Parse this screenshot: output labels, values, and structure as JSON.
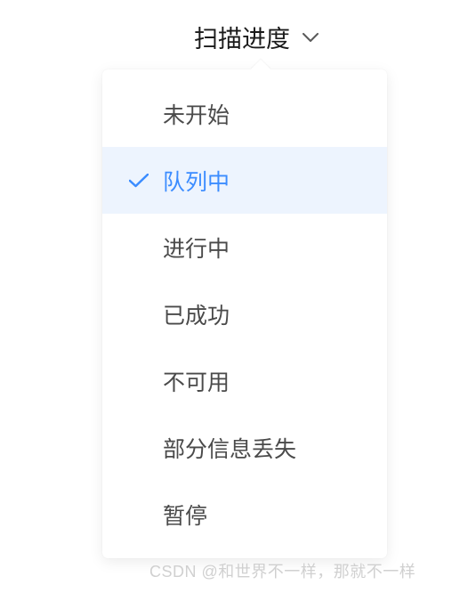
{
  "dropdown": {
    "trigger_label": "扫描进度",
    "selected_index": 1,
    "options": [
      {
        "label": "未开始"
      },
      {
        "label": "队列中"
      },
      {
        "label": "进行中"
      },
      {
        "label": "已成功"
      },
      {
        "label": "不可用"
      },
      {
        "label": "部分信息丢失"
      },
      {
        "label": "暂停"
      }
    ]
  },
  "colors": {
    "accent": "#3b8cff",
    "text": "#4a4a4a",
    "selected_bg": "#edf4fe"
  },
  "watermark": "CSDN @和世界不一样，那就不一样"
}
